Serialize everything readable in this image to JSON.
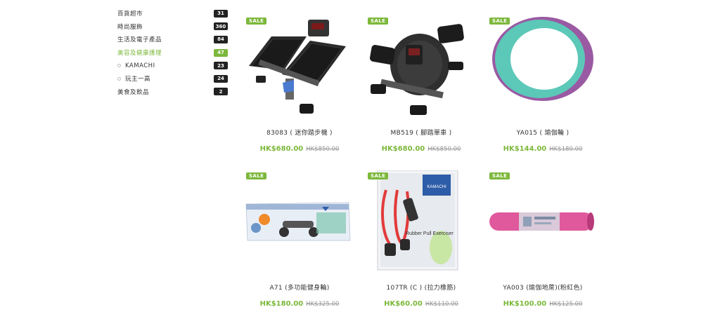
{
  "sidebar": {
    "categories": [
      {
        "label": "百貨超市",
        "count": "31"
      },
      {
        "label": "時尚服飾",
        "count": "360"
      },
      {
        "label": "生活及電子產品",
        "count": "84"
      },
      {
        "label": "美容及健康護理",
        "count": "47",
        "active": true
      },
      {
        "label": "KAMACHI",
        "count": "23",
        "sub": true
      },
      {
        "label": "玩主一高",
        "count": "24",
        "sub": true
      },
      {
        "label": "美食及飲品",
        "count": "2"
      }
    ]
  },
  "colors": {
    "accent": "#7cb83b",
    "badge": "#222222"
  },
  "products": [
    {
      "name": "83083 ( 迷你踏步機 )",
      "price": "HK$680.00",
      "old_price": "HK$850.00",
      "badge": "SALE",
      "image": "mini-stepper"
    },
    {
      "name": "MB519 ( 腳踏單車 )",
      "price": "HK$680.00",
      "old_price": "HK$850.00",
      "badge": "SALE",
      "image": "pedal-exerciser"
    },
    {
      "name": "YA015 ( 瑜伽輪 )",
      "price": "HK$144.00",
      "old_price": "HK$180.00",
      "badge": "SALE",
      "image": "yoga-wheel"
    },
    {
      "name": "A71 (多功能健身輪)",
      "price": "HK$180.00",
      "old_price": "HK$325.00",
      "badge": "SALE",
      "image": "exercise-wheel-box"
    },
    {
      "name": "107TR (C ) (拉力橡筋)",
      "price": "HK$60.00",
      "old_price": "HK$110.00",
      "badge": "SALE",
      "image": "rubber-pull-exerciser"
    },
    {
      "name": "YA003 (瑜伽地蓆)(粉紅色)",
      "price": "HK$100.00",
      "old_price": "HK$125.00",
      "badge": "SALE",
      "image": "yoga-mat-pink"
    }
  ],
  "product_images": {
    "box_brand": "KAMACHI",
    "box_caption": "Rubber Pull Exerciser"
  }
}
